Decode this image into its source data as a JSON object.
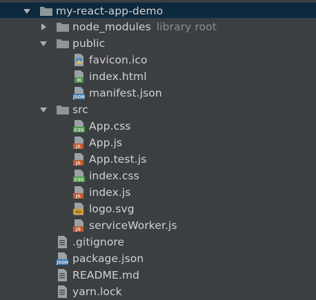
{
  "project_tree": {
    "root": {
      "label": "my-react-app-demo"
    },
    "node_modules": {
      "label": "node_modules",
      "hint": "library root"
    },
    "public": {
      "label": "public",
      "files": [
        {
          "label": "favicon.ico",
          "icon": "image-file-icon"
        },
        {
          "label": "index.html",
          "icon": "html-file-icon"
        },
        {
          "label": "manifest.json",
          "icon": "json-file-icon"
        }
      ]
    },
    "src": {
      "label": "src",
      "files": [
        {
          "label": "App.css",
          "icon": "css-file-icon"
        },
        {
          "label": "App.js",
          "icon": "js-file-icon"
        },
        {
          "label": "App.test.js",
          "icon": "js-file-icon"
        },
        {
          "label": "index.css",
          "icon": "css-file-icon"
        },
        {
          "label": "index.js",
          "icon": "js-file-icon"
        },
        {
          "label": "logo.svg",
          "icon": "svg-file-icon"
        },
        {
          "label": "serviceWorker.js",
          "icon": "js-file-icon"
        }
      ]
    },
    "root_files": [
      {
        "label": ".gitignore",
        "icon": "text-file-icon"
      },
      {
        "label": "package.json",
        "icon": "json-file-icon"
      },
      {
        "label": "README.md",
        "icon": "text-file-icon"
      },
      {
        "label": "yarn.lock",
        "icon": "text-file-icon"
      }
    ]
  },
  "colors": {
    "background": "#3c3f41",
    "selection": "#0d293e",
    "folder": "#8f969a",
    "css": "#4e9a47",
    "js": "#c25a2c",
    "json": "#3a7bb3",
    "html": "#4e9a47"
  }
}
